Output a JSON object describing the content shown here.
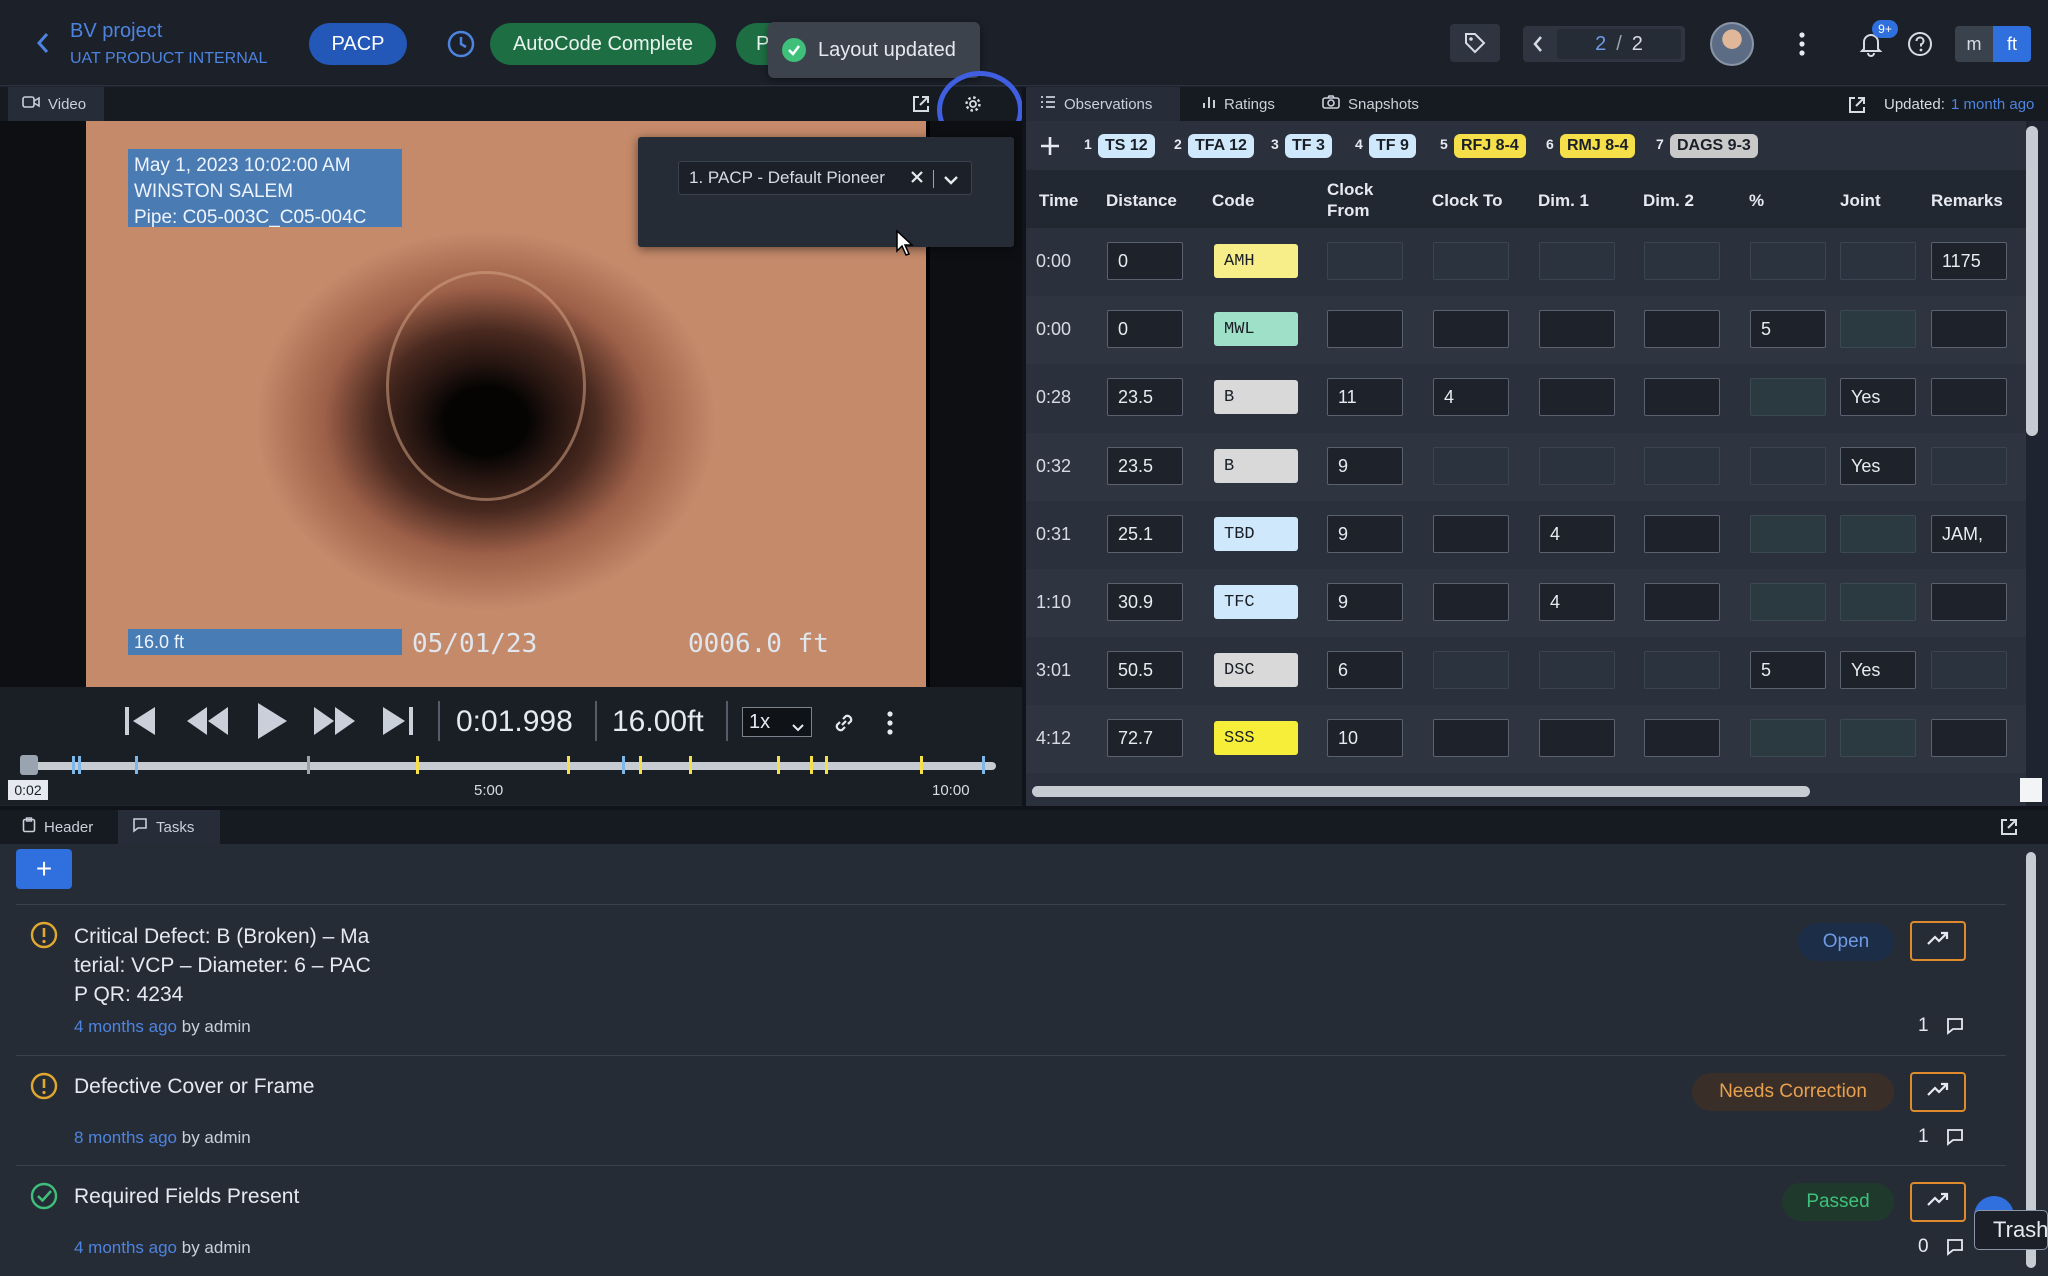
{
  "header": {
    "project_title": "BV project",
    "project_subtitle": "UAT PRODUCT INTERNAL",
    "standard_badge": "PACP",
    "autocode_status": "AutoCode Complete",
    "hidden_pill_text": "P",
    "toast": "Layout updated",
    "pager_current": "2",
    "pager_sep": "/",
    "pager_total": "2",
    "notif_badge": "9+",
    "unit_m": "m",
    "unit_ft": "ft"
  },
  "video_panel": {
    "tab_label": "Video",
    "overlay_date": "May 1, 2023  10:02:00 AM",
    "overlay_city": "WINSTON SALEM",
    "overlay_pipe": "Pipe: C05-003C_C05-004C",
    "overlay_distance": "16.0 ft",
    "burned_date": "05/01/23",
    "burned_distance": "0006.0 ft",
    "layout_select": "1. PACP - Default Pioneer",
    "timecode": "0:01.998",
    "distance": "16.00ft",
    "speed": "1x",
    "timeline_current": "0:02",
    "timeline_mid": "5:00",
    "timeline_end": "10:00"
  },
  "colors": {
    "accent_blue": "#2f6fde",
    "autocode_green": "#1e7a4a",
    "warning_orange": "#e08a2e",
    "passed_green": "#3ec07a",
    "highlight_ring": "#3f5fe0"
  },
  "observations_panel": {
    "tabs": [
      "Observations",
      "Ratings",
      "Snapshots"
    ],
    "updated_label": "Updated:",
    "updated_value": "1 month ago",
    "chips": [
      {
        "num": "1",
        "label": "TS 12",
        "color": "#cfe8fb"
      },
      {
        "num": "2",
        "label": "TFA 12",
        "color": "#cfe8fb"
      },
      {
        "num": "3",
        "label": "TF 3",
        "color": "#cfe8fb"
      },
      {
        "num": "4",
        "label": "TF 9",
        "color": "#cfe8fb"
      },
      {
        "num": "5",
        "label": "RFJ 8-4",
        "color": "#f5e04a"
      },
      {
        "num": "6",
        "label": "RMJ 8-4",
        "color": "#f5e04a"
      },
      {
        "num": "7",
        "label": "DAGS 9-3",
        "color": "#c9c9c9"
      }
    ],
    "columns": [
      "Time",
      "Distance",
      "Code",
      "Clock From",
      "Clock To",
      "Dim. 1",
      "Dim. 2",
      "%",
      "Joint",
      "Remarks"
    ],
    "rows": [
      {
        "time": "0:00",
        "distance": "0",
        "code": "AMH",
        "code_color": "#f7ee8a",
        "clock_from": "",
        "clock_to": "",
        "dim1": "",
        "dim2": "",
        "pct": "",
        "joint": "",
        "remarks": "1175"
      },
      {
        "time": "0:00",
        "distance": "0",
        "code": "MWL",
        "code_color": "#9fe0c9",
        "clock_from": "",
        "clock_to": "",
        "dim1": "",
        "dim2": "",
        "pct": "5",
        "joint": "",
        "remarks": ""
      },
      {
        "time": "0:28",
        "distance": "23.5",
        "code": "B",
        "code_color": "#d9d9d9",
        "clock_from": "11",
        "clock_to": "4",
        "dim1": "",
        "dim2": "",
        "pct": "",
        "joint": "Yes",
        "remarks": ""
      },
      {
        "time": "0:32",
        "distance": "23.5",
        "code": "B",
        "code_color": "#d9d9d9",
        "clock_from": "9",
        "clock_to": "",
        "dim1": "",
        "dim2": "",
        "pct": "",
        "joint": "Yes",
        "remarks": ""
      },
      {
        "time": "0:31",
        "distance": "25.1",
        "code": "TBD",
        "code_color": "#cfe8fb",
        "clock_from": "9",
        "clock_to": "",
        "dim1": "4",
        "dim2": "",
        "pct": "",
        "joint": "",
        "remarks": "JAM,"
      },
      {
        "time": "1:10",
        "distance": "30.9",
        "code": "TFC",
        "code_color": "#cfe8fb",
        "clock_from": "9",
        "clock_to": "",
        "dim1": "4",
        "dim2": "",
        "pct": "",
        "joint": "",
        "remarks": ""
      },
      {
        "time": "3:01",
        "distance": "50.5",
        "code": "DSC",
        "code_color": "#d9d9d9",
        "clock_from": "6",
        "clock_to": "",
        "dim1": "",
        "dim2": "",
        "pct": "5",
        "joint": "Yes",
        "remarks": ""
      },
      {
        "time": "4:12",
        "distance": "72.7",
        "code": "SSS",
        "code_color": "#f7ee3a",
        "clock_from": "10",
        "clock_to": "",
        "dim1": "",
        "dim2": "",
        "pct": "",
        "joint": "",
        "remarks": ""
      }
    ]
  },
  "bottom_panel": {
    "tabs": [
      "Header",
      "Tasks"
    ],
    "add_label": "+",
    "tasks": [
      {
        "title_lines": [
          "Critical Defect: B (Broken) – Ma",
          "terial: VCP – Diameter: 6 – PAC",
          "P QR: 4234"
        ],
        "ago": "4 months ago",
        "by": "by admin",
        "status": "Open",
        "comments": "1"
      },
      {
        "title_lines": [
          "Defective Cover or Frame"
        ],
        "ago": "8 months ago",
        "by": "by admin",
        "status": "Needs Correction",
        "comments": "1"
      },
      {
        "title_lines": [
          "Required Fields Present"
        ],
        "ago": "4 months ago",
        "by": "by admin",
        "status": "Passed",
        "comments": "0"
      }
    ],
    "tooltip": "Trash"
  }
}
